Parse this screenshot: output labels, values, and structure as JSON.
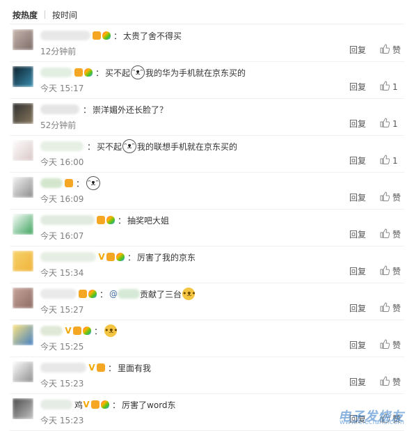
{
  "sort_tabs": [
    {
      "label": "按热度",
      "active": true
    },
    {
      "label": "按时间",
      "active": false
    }
  ],
  "reply_label": "回复",
  "comments": [
    {
      "text": "太贵了舍不得买",
      "time": "12分钟前",
      "likes": "赞",
      "emoji": "",
      "emoji2": "",
      "mention": ""
    },
    {
      "text": "买不起",
      "text2": "我的华为手机就在京东买的",
      "emoji": "husky",
      "time": "今天 15:17",
      "likes": "1"
    },
    {
      "text": "崇洋媚外还长脸了？",
      "time": "52分钟前",
      "likes": "1"
    },
    {
      "text": "买不起",
      "text2": "我的联想手机就在京东买的",
      "emoji": "husky",
      "time": "今天 16:00",
      "likes": "1"
    },
    {
      "text": "",
      "emoji": "husky",
      "time": "今天 16:09",
      "likes": "赞"
    },
    {
      "text": "抽奖吧大姐",
      "time": "今天 16:07",
      "likes": "赞"
    },
    {
      "text": "厉害了我的京东",
      "time": "今天 15:34",
      "likes": "赞"
    },
    {
      "mention": "@",
      "text": "贡献了三台",
      "emoji": "doge",
      "time": "今天 15:27",
      "likes": "赞"
    },
    {
      "text": "",
      "emoji": "doge",
      "time": "今天 15:25",
      "likes": "赞"
    },
    {
      "text": "里面有我",
      "time": "今天 15:23",
      "likes": "赞"
    },
    {
      "text": "厉害了word东",
      "name_suffix": "鸡",
      "time": "今天 15:23",
      "likes": "赞"
    }
  ],
  "watermark": {
    "cn": "电子发烧友",
    "url": "www.elecfans.com"
  },
  "colors": {
    "link": "#3e6a9e",
    "meta": "#808080",
    "watermark": "#2b78c5"
  }
}
